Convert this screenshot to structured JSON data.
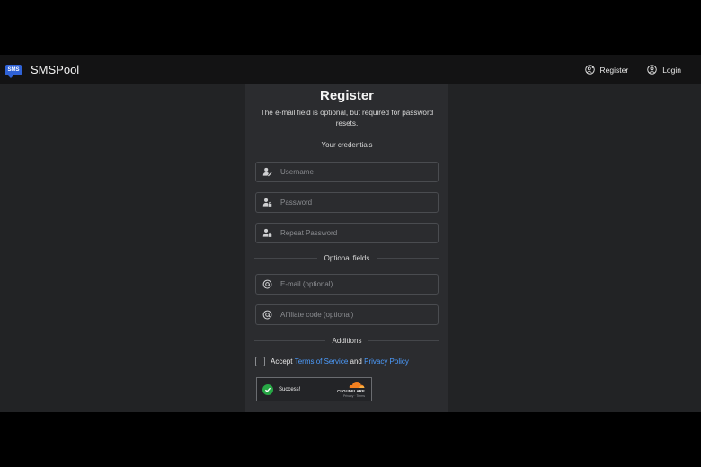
{
  "navbar": {
    "brand_logo_text": "SMS",
    "brand_name": "SMSPool",
    "register_label": "Register",
    "login_label": "Login"
  },
  "form": {
    "title": "Register",
    "subtitle": "The e-mail field is optional, but required for password resets.",
    "sections": {
      "credentials": "Your credentials",
      "optional": "Optional fields",
      "additions": "Additions"
    },
    "fields": {
      "username": {
        "placeholder": "Username",
        "value": ""
      },
      "password": {
        "placeholder": "Password",
        "value": ""
      },
      "repeat_password": {
        "placeholder": "Repeat Password",
        "value": ""
      },
      "email": {
        "placeholder": "E-mail (optional)",
        "value": ""
      },
      "affiliate": {
        "placeholder": "Affiliate code (optional)",
        "value": ""
      }
    },
    "terms": {
      "prefix": "Accept",
      "tos": "Terms of Service",
      "and": "and",
      "privacy": "Privacy Policy",
      "checked": false
    },
    "captcha": {
      "status": "Success!",
      "provider": "CLOUDFLARE",
      "links": "Privacy · Terms"
    }
  },
  "colors": {
    "background": "#222325",
    "navbar": "#131314",
    "card": "#2b2c2f",
    "link": "#4c9dff",
    "brand": "#2f62d6",
    "success": "#27a745",
    "cloudflare": "#f38020"
  },
  "icons": {
    "register": "user-plus-icon",
    "login": "user-circle-icon",
    "username": "user-pen-icon",
    "password": "user-lock-icon",
    "email": "at-icon",
    "captcha": "check-circle-icon"
  }
}
